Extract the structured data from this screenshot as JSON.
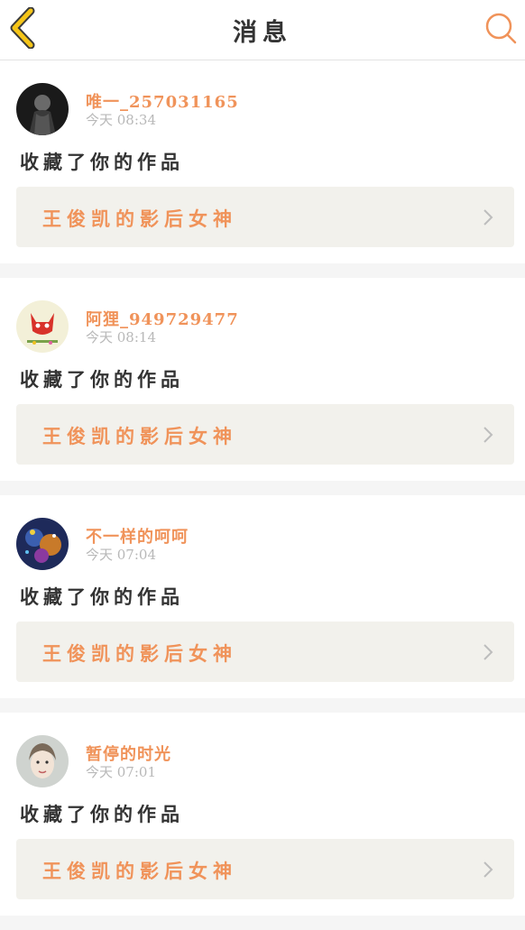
{
  "header": {
    "title": "消息",
    "back_icon": "chevron-left-icon",
    "search_icon": "search-icon",
    "accent_color": "#f0935a",
    "back_color": "#f5c518"
  },
  "notifications": [
    {
      "username": "唯一_257031165",
      "time": "今天 08:34",
      "action": "收藏了你的作品",
      "work_title": "王俊凯的影后女神"
    },
    {
      "username": "阿狸_949729477",
      "time": "今天 08:14",
      "action": "收藏了你的作品",
      "work_title": "王俊凯的影后女神"
    },
    {
      "username": "不一样的呵呵",
      "time": "今天 07:04",
      "action": "收藏了你的作品",
      "work_title": "王俊凯的影后女神"
    },
    {
      "username": "暂停的时光",
      "time": "今天 07:01",
      "action": "收藏了你的作品",
      "work_title": "王俊凯的影后女神"
    }
  ]
}
